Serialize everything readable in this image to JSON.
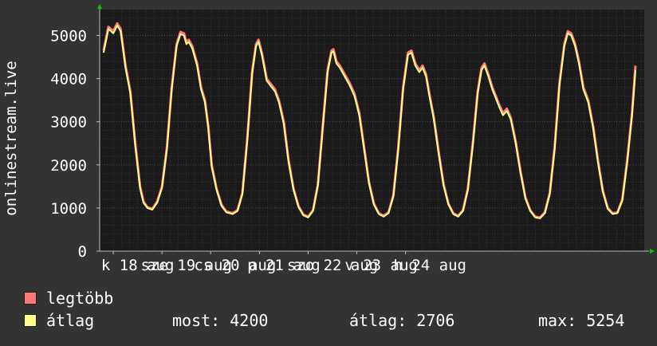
{
  "chart_data": {
    "type": "line",
    "ylabel": "onlinestream.live",
    "ylim": [
      0,
      5600
    ],
    "y_ticks": [
      0,
      1000,
      2000,
      3000,
      4000,
      5000
    ],
    "x_tick_labels": [
      "k 18 aug",
      "sze 19 aug",
      "cs 20 aug",
      "p 21 aug",
      "szo 22 aug",
      "v 23 aug",
      "h 24 aug"
    ],
    "x_tick_labels_display": [
      "k 18 aug",
      "sze 19 aug",
      "cs 20 aug",
      "p 21 aug",
      "szo 22 aug",
      "v 23 aug",
      "h 24 aug"
    ],
    "x_unit": "days since k 18 aug 00:00",
    "grid": true,
    "colors": {
      "background": "#333333",
      "plot": "#1a1a1a",
      "grid": "#4a4a4a",
      "max_series": "#ff7777",
      "avg_series": "#ffff88",
      "axis_arrow": "#00cc00"
    },
    "series": [
      {
        "name": "legtöbb",
        "color": "#ff7777",
        "points": [
          [
            -0.2,
            4650
          ],
          [
            -0.1,
            5200
          ],
          [
            0.0,
            5100
          ],
          [
            0.08,
            5280
          ],
          [
            0.15,
            5150
          ],
          [
            0.25,
            4300
          ],
          [
            0.35,
            3700
          ],
          [
            0.45,
            2500
          ],
          [
            0.55,
            1500
          ],
          [
            0.62,
            1150
          ],
          [
            0.7,
            1020
          ],
          [
            0.8,
            980
          ],
          [
            0.9,
            1150
          ],
          [
            1.0,
            1500
          ],
          [
            1.1,
            2400
          ],
          [
            1.2,
            3800
          ],
          [
            1.3,
            4800
          ],
          [
            1.38,
            5080
          ],
          [
            1.45,
            5050
          ],
          [
            1.5,
            4850
          ],
          [
            1.55,
            4900
          ],
          [
            1.62,
            4750
          ],
          [
            1.72,
            4350
          ],
          [
            1.8,
            3800
          ],
          [
            1.88,
            3500
          ],
          [
            1.95,
            2900
          ],
          [
            2.02,
            2000
          ],
          [
            2.12,
            1450
          ],
          [
            2.22,
            1080
          ],
          [
            2.32,
            920
          ],
          [
            2.45,
            880
          ],
          [
            2.55,
            950
          ],
          [
            2.65,
            1350
          ],
          [
            2.75,
            2600
          ],
          [
            2.85,
            4150
          ],
          [
            2.93,
            4800
          ],
          [
            2.98,
            4900
          ],
          [
            3.05,
            4600
          ],
          [
            3.15,
            4000
          ],
          [
            3.25,
            3850
          ],
          [
            3.32,
            3750
          ],
          [
            3.4,
            3500
          ],
          [
            3.5,
            3000
          ],
          [
            3.6,
            2100
          ],
          [
            3.7,
            1450
          ],
          [
            3.8,
            1050
          ],
          [
            3.9,
            850
          ],
          [
            4.0,
            800
          ],
          [
            4.1,
            950
          ],
          [
            4.2,
            1550
          ],
          [
            4.3,
            2900
          ],
          [
            4.4,
            4200
          ],
          [
            4.48,
            4650
          ],
          [
            4.52,
            4680
          ],
          [
            4.58,
            4400
          ],
          [
            4.65,
            4300
          ],
          [
            4.75,
            4100
          ],
          [
            4.85,
            3900
          ],
          [
            4.95,
            3650
          ],
          [
            5.05,
            3200
          ],
          [
            5.15,
            2400
          ],
          [
            5.25,
            1600
          ],
          [
            5.35,
            1100
          ],
          [
            5.45,
            880
          ],
          [
            5.55,
            820
          ],
          [
            5.65,
            900
          ],
          [
            5.75,
            1300
          ],
          [
            5.85,
            2400
          ],
          [
            5.95,
            3800
          ],
          [
            6.05,
            4600
          ],
          [
            6.12,
            4650
          ],
          [
            6.2,
            4350
          ],
          [
            6.28,
            4200
          ],
          [
            6.35,
            4300
          ],
          [
            6.42,
            4100
          ],
          [
            6.48,
            3700
          ],
          [
            6.58,
            3100
          ],
          [
            6.68,
            2300
          ],
          [
            6.78,
            1550
          ],
          [
            6.88,
            1100
          ],
          [
            6.98,
            880
          ],
          [
            7.08,
            820
          ],
          [
            7.18,
            950
          ],
          [
            7.28,
            1450
          ],
          [
            7.38,
            2500
          ],
          [
            7.48,
            3700
          ],
          [
            7.56,
            4250
          ],
          [
            7.62,
            4350
          ],
          [
            7.7,
            4100
          ],
          [
            7.78,
            3800
          ],
          [
            7.85,
            3600
          ],
          [
            7.92,
            3400
          ],
          [
            8.0,
            3200
          ],
          [
            8.08,
            3300
          ],
          [
            8.16,
            3100
          ],
          [
            8.26,
            2550
          ],
          [
            8.36,
            1850
          ],
          [
            8.46,
            1250
          ],
          [
            8.56,
            950
          ],
          [
            8.66,
            800
          ],
          [
            8.76,
            780
          ],
          [
            8.86,
            900
          ],
          [
            8.96,
            1350
          ],
          [
            9.06,
            2400
          ],
          [
            9.16,
            3900
          ],
          [
            9.26,
            4800
          ],
          [
            9.33,
            5100
          ],
          [
            9.4,
            5050
          ],
          [
            9.48,
            4800
          ],
          [
            9.56,
            4400
          ],
          [
            9.65,
            3800
          ],
          [
            9.75,
            3500
          ],
          [
            9.85,
            2900
          ],
          [
            9.95,
            2100
          ],
          [
            10.05,
            1400
          ],
          [
            10.15,
            1000
          ],
          [
            10.25,
            880
          ],
          [
            10.35,
            900
          ],
          [
            10.45,
            1200
          ],
          [
            10.55,
            2100
          ],
          [
            10.65,
            3200
          ],
          [
            10.72,
            4300
          ]
        ]
      },
      {
        "name": "átlag",
        "color": "#ffff88",
        "points": [
          [
            -0.2,
            4600
          ],
          [
            -0.1,
            5150
          ],
          [
            0.0,
            5050
          ],
          [
            0.08,
            5230
          ],
          [
            0.15,
            5100
          ],
          [
            0.25,
            4250
          ],
          [
            0.35,
            3650
          ],
          [
            0.45,
            2450
          ],
          [
            0.55,
            1450
          ],
          [
            0.62,
            1120
          ],
          [
            0.7,
            1000
          ],
          [
            0.8,
            960
          ],
          [
            0.9,
            1120
          ],
          [
            1.0,
            1470
          ],
          [
            1.1,
            2350
          ],
          [
            1.2,
            3750
          ],
          [
            1.3,
            4750
          ],
          [
            1.38,
            5030
          ],
          [
            1.45,
            5000
          ],
          [
            1.5,
            4800
          ],
          [
            1.55,
            4850
          ],
          [
            1.62,
            4700
          ],
          [
            1.72,
            4300
          ],
          [
            1.8,
            3750
          ],
          [
            1.88,
            3450
          ],
          [
            1.95,
            2850
          ],
          [
            2.02,
            1950
          ],
          [
            2.12,
            1420
          ],
          [
            2.22,
            1050
          ],
          [
            2.32,
            900
          ],
          [
            2.45,
            860
          ],
          [
            2.55,
            930
          ],
          [
            2.65,
            1320
          ],
          [
            2.75,
            2550
          ],
          [
            2.85,
            4100
          ],
          [
            2.93,
            4750
          ],
          [
            2.98,
            4850
          ],
          [
            3.05,
            4550
          ],
          [
            3.15,
            3950
          ],
          [
            3.25,
            3800
          ],
          [
            3.32,
            3700
          ],
          [
            3.4,
            3450
          ],
          [
            3.5,
            2950
          ],
          [
            3.6,
            2050
          ],
          [
            3.7,
            1420
          ],
          [
            3.8,
            1020
          ],
          [
            3.9,
            830
          ],
          [
            4.0,
            780
          ],
          [
            4.1,
            930
          ],
          [
            4.2,
            1520
          ],
          [
            4.3,
            2850
          ],
          [
            4.4,
            4150
          ],
          [
            4.48,
            4600
          ],
          [
            4.52,
            4630
          ],
          [
            4.58,
            4350
          ],
          [
            4.65,
            4250
          ],
          [
            4.75,
            4050
          ],
          [
            4.85,
            3850
          ],
          [
            4.95,
            3600
          ],
          [
            5.05,
            3150
          ],
          [
            5.15,
            2350
          ],
          [
            5.25,
            1570
          ],
          [
            5.35,
            1080
          ],
          [
            5.45,
            860
          ],
          [
            5.55,
            800
          ],
          [
            5.65,
            880
          ],
          [
            5.75,
            1270
          ],
          [
            5.85,
            2350
          ],
          [
            5.95,
            3750
          ],
          [
            6.05,
            4550
          ],
          [
            6.12,
            4600
          ],
          [
            6.2,
            4300
          ],
          [
            6.28,
            4150
          ],
          [
            6.35,
            4250
          ],
          [
            6.42,
            4050
          ],
          [
            6.48,
            3650
          ],
          [
            6.58,
            3050
          ],
          [
            6.68,
            2250
          ],
          [
            6.78,
            1520
          ],
          [
            6.88,
            1080
          ],
          [
            6.98,
            860
          ],
          [
            7.08,
            800
          ],
          [
            7.18,
            930
          ],
          [
            7.28,
            1420
          ],
          [
            7.38,
            2450
          ],
          [
            7.48,
            3650
          ],
          [
            7.56,
            4200
          ],
          [
            7.62,
            4300
          ],
          [
            7.7,
            4050
          ],
          [
            7.78,
            3750
          ],
          [
            7.85,
            3550
          ],
          [
            7.92,
            3350
          ],
          [
            8.0,
            3150
          ],
          [
            8.08,
            3250
          ],
          [
            8.16,
            3050
          ],
          [
            8.26,
            2500
          ],
          [
            8.36,
            1820
          ],
          [
            8.46,
            1220
          ],
          [
            8.56,
            930
          ],
          [
            8.66,
            780
          ],
          [
            8.76,
            760
          ],
          [
            8.86,
            880
          ],
          [
            8.96,
            1320
          ],
          [
            9.06,
            2350
          ],
          [
            9.16,
            3850
          ],
          [
            9.26,
            4750
          ],
          [
            9.33,
            5050
          ],
          [
            9.4,
            5000
          ],
          [
            9.48,
            4750
          ],
          [
            9.56,
            4350
          ],
          [
            9.65,
            3750
          ],
          [
            9.75,
            3450
          ],
          [
            9.85,
            2850
          ],
          [
            9.95,
            2050
          ],
          [
            10.05,
            1370
          ],
          [
            10.15,
            980
          ],
          [
            10.25,
            860
          ],
          [
            10.35,
            880
          ],
          [
            10.45,
            1170
          ],
          [
            10.55,
            2050
          ],
          [
            10.65,
            3150
          ],
          [
            10.72,
            4200
          ]
        ]
      }
    ]
  },
  "legend": [
    {
      "label": "legtöbb",
      "color": "#ff7777"
    },
    {
      "label": "átlag",
      "color": "#ffff88"
    }
  ],
  "stats": {
    "now": "most: 4200",
    "avg": "átlag: 2706",
    "max": "max: 5254"
  }
}
